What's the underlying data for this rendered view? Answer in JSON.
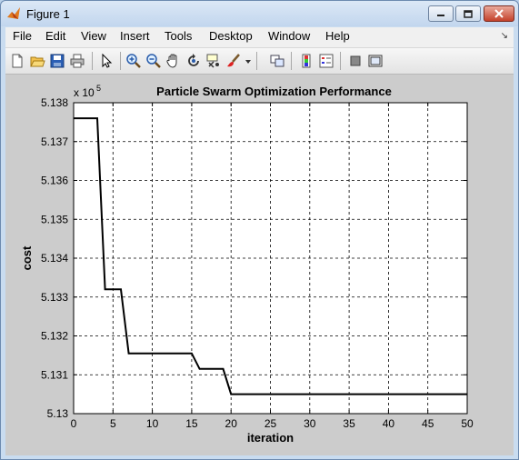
{
  "window": {
    "title": "Figure 1",
    "accent": "#c9dcf0",
    "controls": {
      "minimize": "minimize-icon",
      "maximize": "maximize-icon",
      "close": "close-icon"
    }
  },
  "menubar": {
    "items": [
      "File",
      "Edit",
      "View",
      "Insert",
      "Tools",
      "Desktop",
      "Window",
      "Help"
    ],
    "overflow_icon": "dock-arrow-icon"
  },
  "toolbar": {
    "buttons": [
      "new-figure-icon",
      "open-file-icon",
      "save-icon",
      "print-icon",
      "edit-plot-arrow-icon",
      "zoom-in-icon",
      "zoom-out-icon",
      "pan-hand-icon",
      "rotate-3d-icon",
      "data-cursor-icon",
      "brush-icon",
      "brush-dropdown-icon",
      "link-plot-icon",
      "insert-colorbar-icon",
      "insert-legend-icon",
      "hide-plot-tools-icon",
      "show-plot-tools-icon"
    ]
  },
  "chart_data": {
    "type": "line",
    "title": "Particle Swarm Optimization Performance",
    "xlabel": "iteration",
    "ylabel": "cost",
    "y_multiplier": "x 10",
    "y_multiplier_exp": "5",
    "xlim": [
      0,
      50
    ],
    "ylim": [
      5.13,
      5.138
    ],
    "xticks": [
      "0",
      "5",
      "10",
      "15",
      "20",
      "25",
      "30",
      "35",
      "40",
      "45",
      "50"
    ],
    "yticks": [
      "5.13",
      "5.131",
      "5.132",
      "5.133",
      "5.134",
      "5.135",
      "5.136",
      "5.137",
      "5.138"
    ],
    "grid": true,
    "line_color": "#000000",
    "series": [
      {
        "x": [
          0,
          3,
          4,
          6,
          7,
          15,
          16,
          19,
          20,
          50
        ],
        "values": [
          5.1376,
          5.1376,
          5.1332,
          5.1332,
          5.13155,
          5.13155,
          5.13115,
          5.13115,
          5.1305,
          5.1305
        ]
      }
    ]
  }
}
